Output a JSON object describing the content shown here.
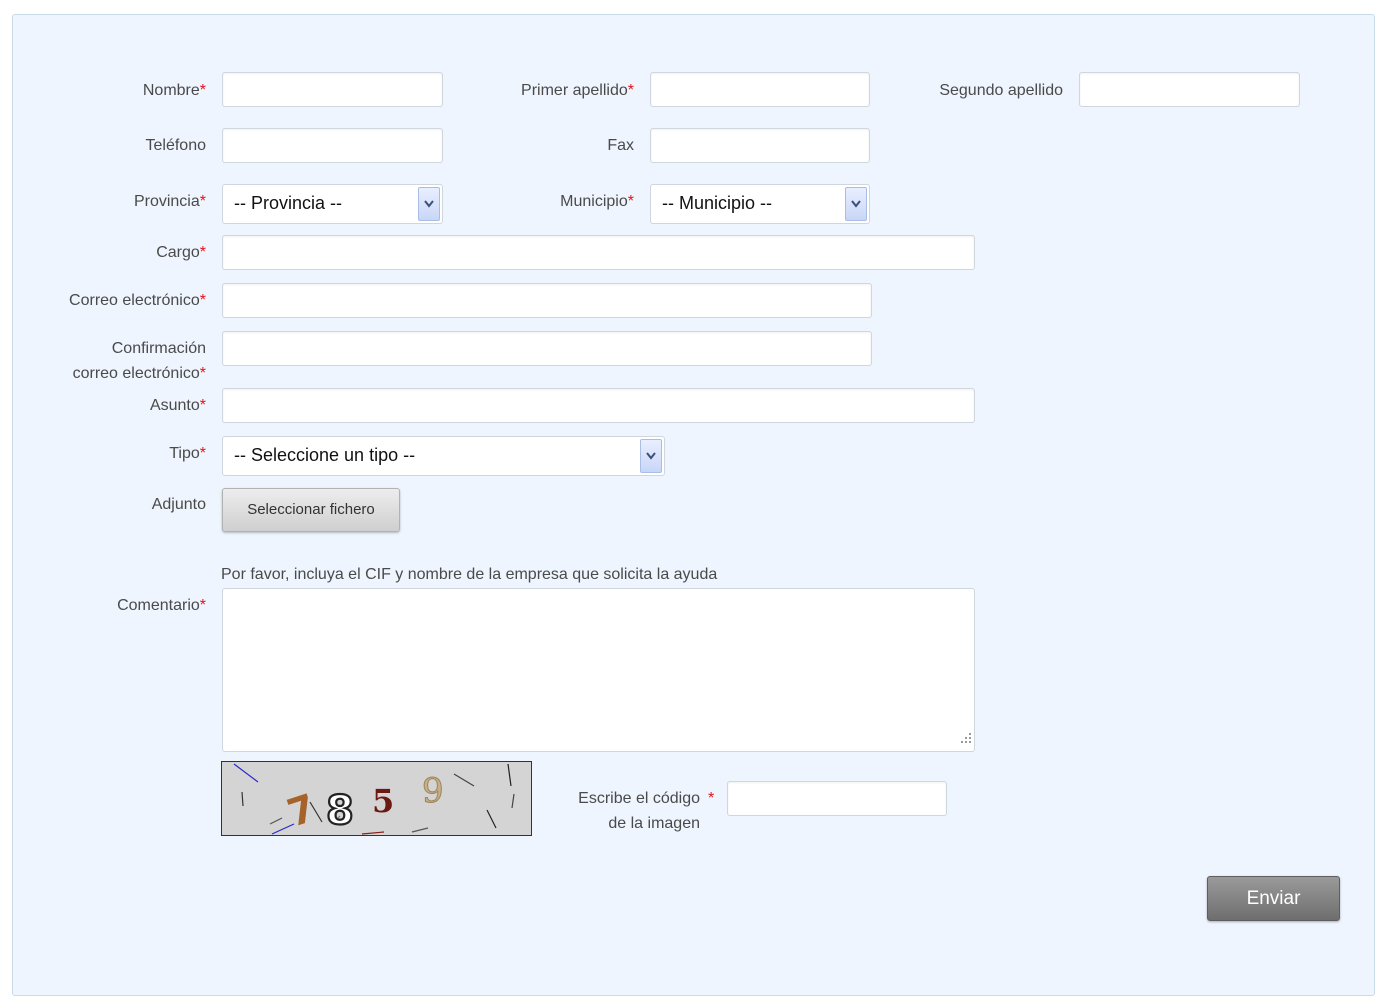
{
  "form": {
    "nombre": {
      "label": "Nombre",
      "value": ""
    },
    "primer_apellido": {
      "label": "Primer apellido",
      "value": ""
    },
    "segundo_apellido": {
      "label": "Segundo apellido",
      "value": ""
    },
    "telefono": {
      "label": "Teléfono",
      "value": ""
    },
    "fax": {
      "label": "Fax",
      "value": ""
    },
    "provincia": {
      "label": "Provincia",
      "selected": "-- Provincia --"
    },
    "municipio": {
      "label": "Municipio",
      "selected": "-- Municipio --"
    },
    "cargo": {
      "label": "Cargo",
      "value": ""
    },
    "correo": {
      "label": "Correo electrónico",
      "value": ""
    },
    "confirmacion": {
      "label_line1": "Confirmación",
      "label_line2": "correo electrónico",
      "value": ""
    },
    "asunto": {
      "label": "Asunto",
      "value": ""
    },
    "tipo": {
      "label": "Tipo",
      "selected": "-- Seleccione un tipo --"
    },
    "adjunto": {
      "label": "Adjunto",
      "button": "Seleccionar fichero"
    },
    "comentario": {
      "label": "Comentario",
      "hint": "Por favor, incluya el CIF y nombre de la empresa que solicita la ayuda",
      "value": ""
    },
    "captcha": {
      "code": "7859",
      "label_line1": "Escribe el código",
      "label_line2": "de la imagen",
      "value": ""
    },
    "required_mark": "*",
    "submit": "Enviar"
  },
  "colors": {
    "required": "#e8101a",
    "panel_bg": "#eef5fe",
    "submit_bg": "#7f7f7f"
  }
}
